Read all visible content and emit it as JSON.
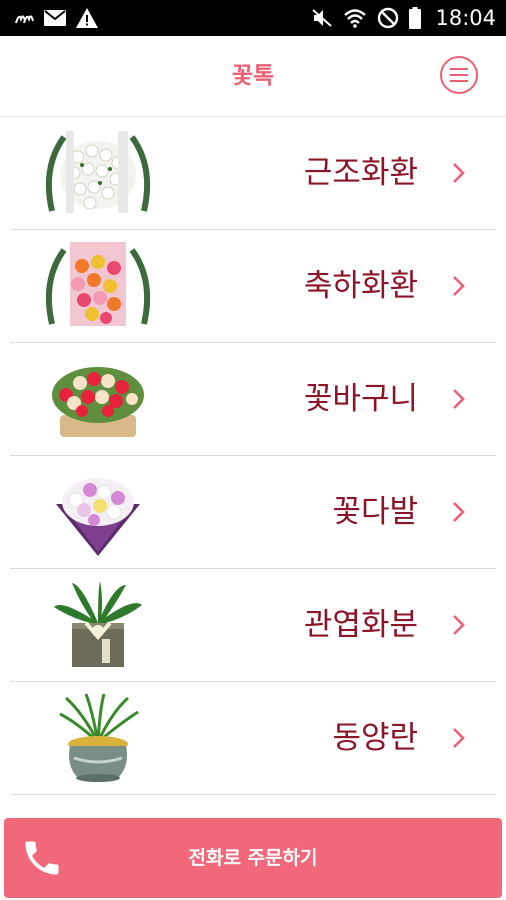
{
  "status_bar": {
    "time": "18:04",
    "left_icons": [
      "carrier-logo-icon",
      "mail-icon",
      "warning-icon"
    ],
    "right_icons": [
      "vibrate-mute-icon",
      "wifi-icon",
      "do-not-disturb-icon",
      "battery-icon"
    ]
  },
  "header": {
    "title": "꽃톡",
    "menu_icon": "hamburger-menu-icon"
  },
  "categories": [
    {
      "label": "근조화환",
      "icon": "funeral-wreath-image"
    },
    {
      "label": "축하화환",
      "icon": "celebration-wreath-image"
    },
    {
      "label": "꽃바구니",
      "icon": "flower-basket-image"
    },
    {
      "label": "꽃다발",
      "icon": "bouquet-image"
    },
    {
      "label": "관엽화분",
      "icon": "foliage-plant-pot-image"
    },
    {
      "label": "동양란",
      "icon": "orchid-pot-image"
    }
  ],
  "call_bar": {
    "label": "전화로 주문하기",
    "icon": "phone-icon"
  },
  "colors": {
    "accent": "#ee5f74",
    "label": "#8c1426",
    "call_bar": "#f0687a",
    "status_bar": "#000000"
  }
}
